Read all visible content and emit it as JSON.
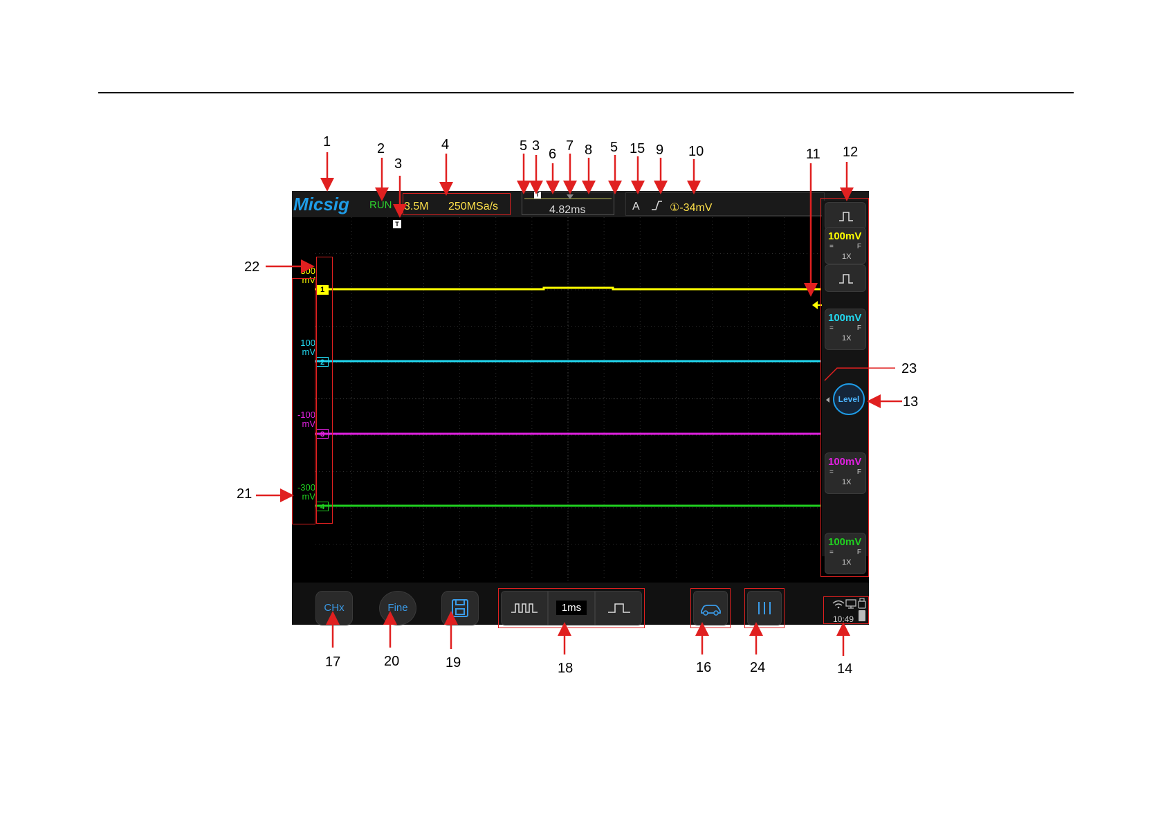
{
  "callouts": [
    "1",
    "2",
    "3",
    "3",
    "4",
    "5",
    "3",
    "6",
    "7",
    "8",
    "5",
    "15",
    "9",
    "10",
    "11",
    "12",
    "22",
    "21",
    "23",
    "13",
    "17",
    "20",
    "19",
    "18",
    "16",
    "24",
    "14"
  ],
  "scope": {
    "logo": "Micsig",
    "run_state": "RUN",
    "memory_depth": "3.5M",
    "sample_rate": "250MSa/s",
    "trigger_position": "4.82ms",
    "trigger_marker": "T",
    "trigger_mode": "A",
    "trigger_edge_icon": "rising-edge-icon",
    "trigger_source_level": "①-34mV",
    "level_button": "Level",
    "timebase": "1ms",
    "chx_button": "CHx",
    "fine_button": "Fine",
    "clock": "10:49",
    "status_icons": [
      "wifi-icon",
      "monitor-icon",
      "usb-icon",
      "battery-icon"
    ]
  },
  "channels": [
    {
      "id": "1",
      "color": "#ffff00",
      "offset_value": "300",
      "offset_unit": "mV",
      "scale": "100mV",
      "coupling": "=",
      "bw": "F",
      "probe": "1X"
    },
    {
      "id": "2",
      "color": "#22d8f0",
      "offset_value": "100",
      "offset_unit": "mV",
      "scale": "100mV",
      "coupling": "=",
      "bw": "F",
      "probe": "1X"
    },
    {
      "id": "3",
      "color": "#e020e0",
      "offset_value": "-100",
      "offset_unit": "mV",
      "scale": "100mV",
      "coupling": "=",
      "bw": "F",
      "probe": "1X"
    },
    {
      "id": "4",
      "color": "#20d020",
      "offset_value": "-300",
      "offset_unit": "mV",
      "scale": "100mV",
      "coupling": "=",
      "bw": "F",
      "probe": "1X"
    }
  ]
}
